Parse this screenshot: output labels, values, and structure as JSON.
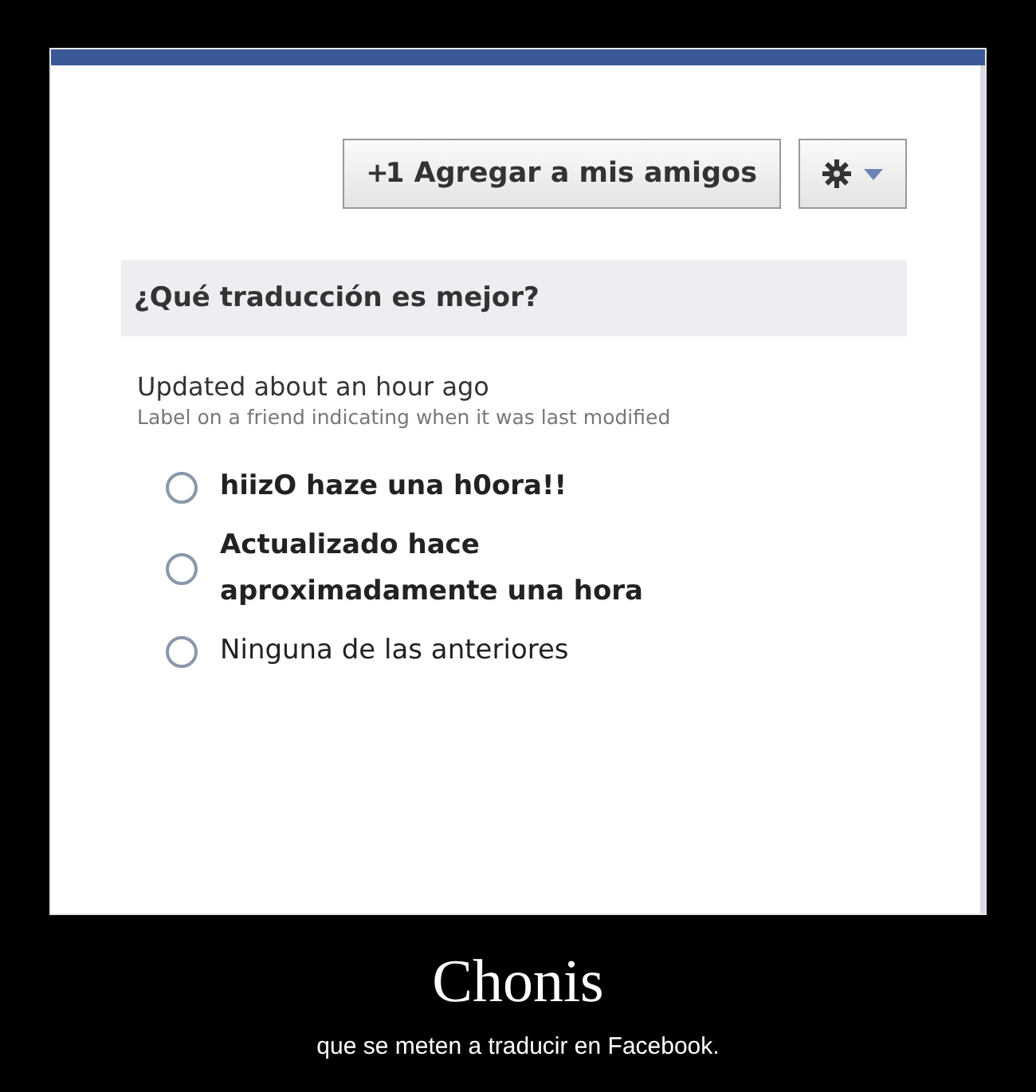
{
  "add_friend_button": {
    "icon_text": "+1",
    "label": "Agregar a mis amigos"
  },
  "question": {
    "title": "¿Qué traducción es mejor?"
  },
  "source": {
    "text": "Updated about an hour ago",
    "description": "Label on a friend indicating when it was last modified"
  },
  "options": [
    {
      "label": "hiizO haze una h0ora!!",
      "bold": true,
      "selected": false
    },
    {
      "label": "Actualizado hace aproximadamente una hora",
      "bold": true,
      "selected": false
    },
    {
      "label": "Ninguna de las anteriores",
      "bold": false,
      "selected": false
    }
  ],
  "poster": {
    "title": "Chonis",
    "caption": "que se meten a traducir en Facebook."
  }
}
